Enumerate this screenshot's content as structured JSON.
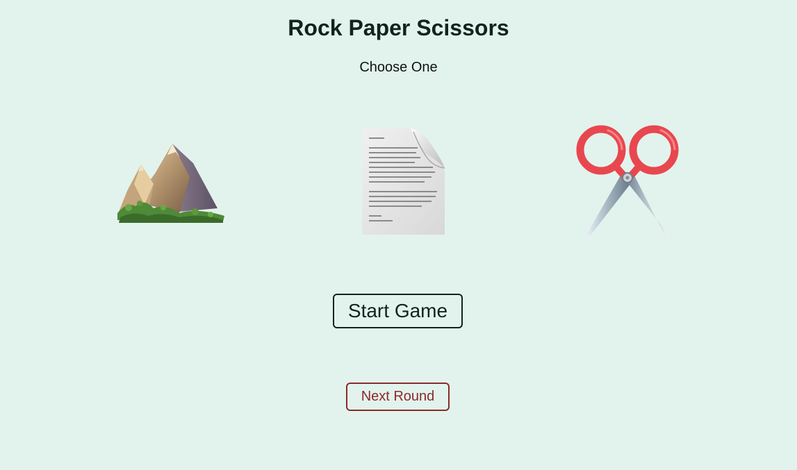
{
  "header": {
    "title": "Rock Paper Scissors",
    "subtitle": "Choose One"
  },
  "choices": [
    {
      "id": "rock",
      "icon": "mountain-icon"
    },
    {
      "id": "paper",
      "icon": "page-facing-up-icon"
    },
    {
      "id": "scissors",
      "icon": "scissors-icon"
    }
  ],
  "controls": {
    "start_label": "Start Game",
    "next_label": "Next Round"
  },
  "colors": {
    "background": "#e2f3ed",
    "text": "#12231d",
    "next_button": "#8b2a2a"
  }
}
